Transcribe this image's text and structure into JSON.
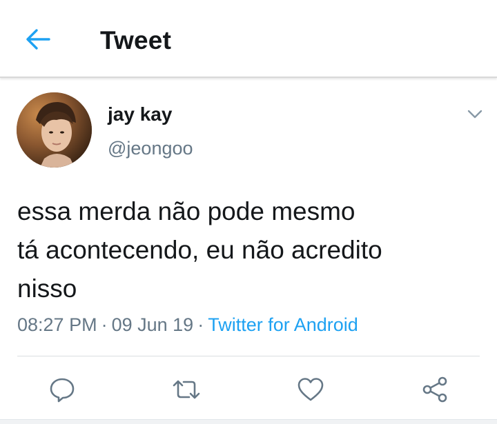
{
  "header": {
    "title": "Tweet",
    "back_icon": "arrow-left-icon"
  },
  "tweet": {
    "author": {
      "display_name": "jay kay",
      "handle": "@jeongoo"
    },
    "text": "essa merda não pode mesmo\ntá acontecendo, eu não acredito\nnisso",
    "time": "08:27 PM",
    "date": "09 Jun 19",
    "separator": "·",
    "source": "Twitter for Android"
  },
  "actions": {
    "reply_icon": "reply-icon",
    "retweet_icon": "retweet-icon",
    "like_icon": "heart-icon",
    "share_icon": "share-icon"
  },
  "colors": {
    "accent": "#1da1f2",
    "text_primary": "#14171a",
    "text_secondary": "#657786",
    "icon_gray": "#657786"
  }
}
